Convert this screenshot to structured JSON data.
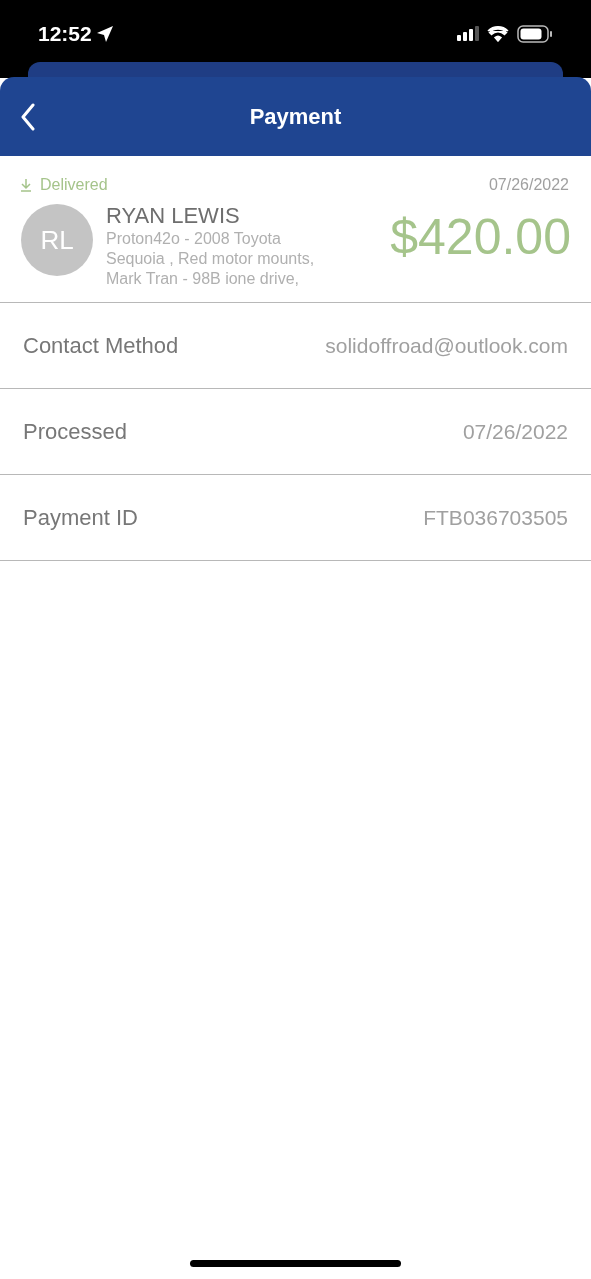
{
  "status_bar": {
    "time": "12:52"
  },
  "header": {
    "title": "Payment"
  },
  "payment": {
    "status": "Delivered",
    "date": "07/26/2022",
    "initials": "RL",
    "name": "RYAN LEWIS",
    "description_lines": [
      "Proton42o - 2008 Toyota",
      "Sequoia , Red motor mounts,",
      "Mark Tran - 98B ione drive,"
    ],
    "amount": "$420.00"
  },
  "details": [
    {
      "label": "Contact Method",
      "value": "solidoffroad@outlook.com"
    },
    {
      "label": "Processed",
      "value": "07/26/2022"
    },
    {
      "label": "Payment ID",
      "value": "FTB036703505"
    }
  ]
}
